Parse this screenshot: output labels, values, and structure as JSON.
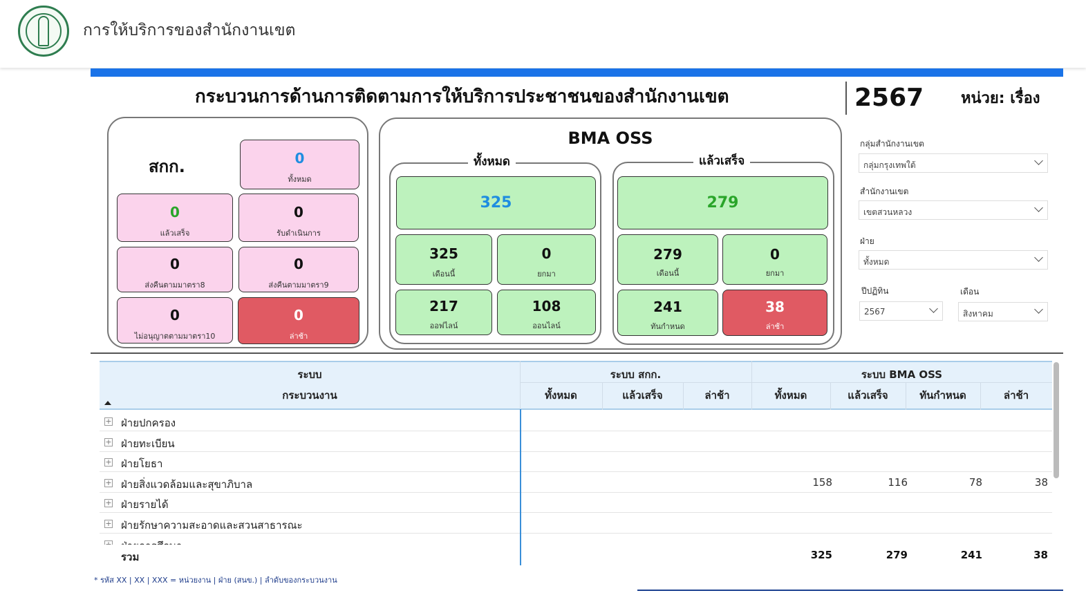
{
  "header": {
    "title": "การให้บริการของสำนักงานเขต",
    "logo": "bma-seal-icon"
  },
  "main_title": "กระบวนการด้านการติดตามการให้บริการประชาชนของสำนักงานเขต",
  "year": "2567",
  "unit": "หน่วย: เรื่อง",
  "skk": {
    "title": "สกก.",
    "total": {
      "value": "0",
      "label": "ทั้งหมด"
    },
    "done": {
      "value": "0",
      "label": "แล้วเสร็จ"
    },
    "received": {
      "value": "0",
      "label": "รับดำเนินการ"
    },
    "return8": {
      "value": "0",
      "label": "ส่งคืนตามมาตรา8"
    },
    "return9": {
      "value": "0",
      "label": "ส่งคืนตามมาตรา9"
    },
    "notallowed10": {
      "value": "0",
      "label": "ไม่อนุญาตตามมาตรา10"
    },
    "late": {
      "value": "0",
      "label": "ล่าช้า"
    }
  },
  "oss": {
    "title": "BMA OSS",
    "all": {
      "title": "ทั้งหมด",
      "total": "325",
      "this_month": {
        "value": "325",
        "label": "เดือนนี้"
      },
      "carried": {
        "value": "0",
        "label": "ยกมา"
      },
      "offline": {
        "value": "217",
        "label": "ออฟไลน์"
      },
      "online": {
        "value": "108",
        "label": "ออนไลน์"
      }
    },
    "done": {
      "title": "แล้วเสร็จ",
      "total": "279",
      "this_month": {
        "value": "279",
        "label": "เดือนนี้"
      },
      "carried": {
        "value": "0",
        "label": "ยกมา"
      },
      "on_time": {
        "value": "241",
        "label": "ทันกำหนด"
      },
      "late": {
        "value": "38",
        "label": "ล่าช้า"
      }
    }
  },
  "filters": {
    "group": {
      "label": "กลุ่มสำนักงานเขต",
      "value": "กลุ่มกรุงเทพใต้"
    },
    "district": {
      "label": "สำนักงานเขต",
      "value": "เขตสวนหลวง"
    },
    "division": {
      "label": "ฝ่าย",
      "value": "ทั้งหมด"
    },
    "fiscal_year": {
      "label": "ปีปฏิทิน",
      "value": "2567"
    },
    "month": {
      "label": "เดือน",
      "value": "สิงหาคม"
    }
  },
  "table": {
    "group_headers": {
      "system": "ระบบ",
      "skk": "ระบบ สกก.",
      "oss": "ระบบ BMA OSS"
    },
    "columns": [
      "กระบวนงาน",
      "ทั้งหมด",
      "แล้วเสร็จ",
      "ล่าช้า",
      "ทั้งหมด",
      "แล้วเสร็จ",
      "ทันกำหนด",
      "ล่าช้า"
    ],
    "rows": [
      {
        "name": "ฝ่ายปกครอง",
        "cells": [
          "",
          "",
          "",
          "",
          "",
          "",
          ""
        ]
      },
      {
        "name": "ฝ่ายทะเบียน",
        "cells": [
          "",
          "",
          "",
          "",
          "",
          "",
          ""
        ]
      },
      {
        "name": "ฝ่ายโยธา",
        "cells": [
          "",
          "",
          "",
          "",
          "",
          "",
          ""
        ]
      },
      {
        "name": "ฝ่ายสิ่งแวดล้อมและสุขาภิบาล",
        "cells": [
          "",
          "",
          "",
          "158",
          "116",
          "78",
          "38"
        ]
      },
      {
        "name": "ฝ่ายรายได้",
        "cells": [
          "",
          "",
          "",
          "",
          "",
          "",
          ""
        ]
      },
      {
        "name": "ฝ่ายรักษาความสะอาดและสวนสาธารณะ",
        "cells": [
          "",
          "",
          "",
          "",
          "",
          "",
          ""
        ]
      },
      {
        "name": "ฝ่ายการศึกษา",
        "cells": [
          "",
          "",
          "",
          "",
          "",
          "",
          ""
        ]
      }
    ],
    "total": {
      "name": "รวม",
      "cells": [
        "",
        "",
        "",
        "325",
        "279",
        "241",
        "38"
      ]
    }
  },
  "footnote": "* รหัส XX | XX | XXX = หน่วยงาน | ฝ่าย (สนข.) | ลำดับของกระบวนงาน",
  "colors": {
    "accent_blue": "#1a73e8",
    "pink": "#fbd3ec",
    "green": "#bdf2bd",
    "red": "#e05a63",
    "value_blue": "#1f8de0",
    "value_green": "#2aa52a"
  }
}
